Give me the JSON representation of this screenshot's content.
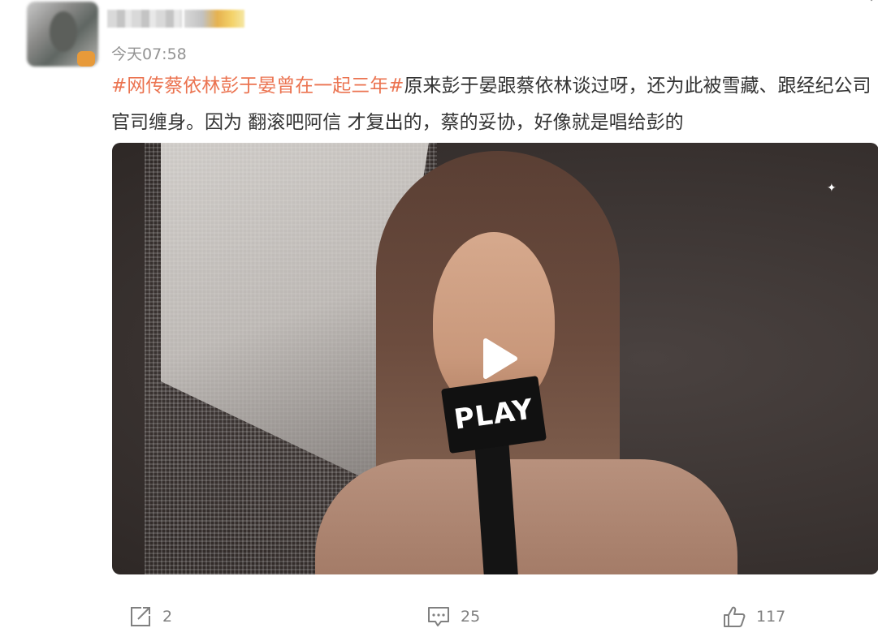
{
  "post": {
    "timestamp": "今天07:58",
    "topic": "#网传蔡依林彭于晏曾在一起三年#",
    "text": "原来彭于晏跟蔡依林谈过呀，还为此被雪藏、跟经纪公司官司缠身。因为 翻滚吧阿信 才复出的，蔡的妥协，好像就是唱给彭的"
  },
  "video": {
    "mic_label": "PLAY"
  },
  "actions": {
    "repost_count": "2",
    "comment_count": "25",
    "like_count": "117"
  },
  "colors": {
    "topic": "#eb7350",
    "meta": "#939393",
    "action": "#808080"
  },
  "icons": [
    "chevron-down-icon",
    "play-icon",
    "repost-icon",
    "comment-icon",
    "like-icon"
  ]
}
